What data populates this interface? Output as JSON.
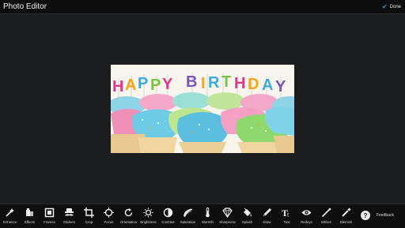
{
  "app": {
    "title": "Photo Editor",
    "done_label": "Done"
  },
  "photo": {
    "banner_text": "HAPPY BIRTHDAY"
  },
  "tools": [
    {
      "label": "Enhance",
      "icon": "magic-wand-icon"
    },
    {
      "label": "Effects",
      "icon": "effects-icon"
    },
    {
      "label": "Frames",
      "icon": "frame-icon"
    },
    {
      "label": "Stickers",
      "icon": "mustache-sticker-icon"
    },
    {
      "label": "Crop",
      "icon": "crop-icon"
    },
    {
      "label": "Focus",
      "icon": "focus-icon"
    },
    {
      "label": "Orientation",
      "icon": "rotate-icon"
    },
    {
      "label": "Brightness",
      "icon": "brightness-icon"
    },
    {
      "label": "Contrast",
      "icon": "contrast-icon"
    },
    {
      "label": "Saturation",
      "icon": "saturation-icon"
    },
    {
      "label": "Warmth",
      "icon": "thermometer-icon"
    },
    {
      "label": "Sharpness",
      "icon": "diamond-icon"
    },
    {
      "label": "Splash",
      "icon": "paint-bucket-icon"
    },
    {
      "label": "Draw",
      "icon": "pencil-icon"
    },
    {
      "label": "Text",
      "icon": "text-icon"
    },
    {
      "label": "Redeye",
      "icon": "eye-icon"
    },
    {
      "label": "Whiten",
      "icon": "whiten-wand-icon"
    },
    {
      "label": "Blemish",
      "icon": "blemish-brush-icon"
    }
  ],
  "feedback": {
    "label": "Feedback",
    "icon_glyph": "?"
  }
}
